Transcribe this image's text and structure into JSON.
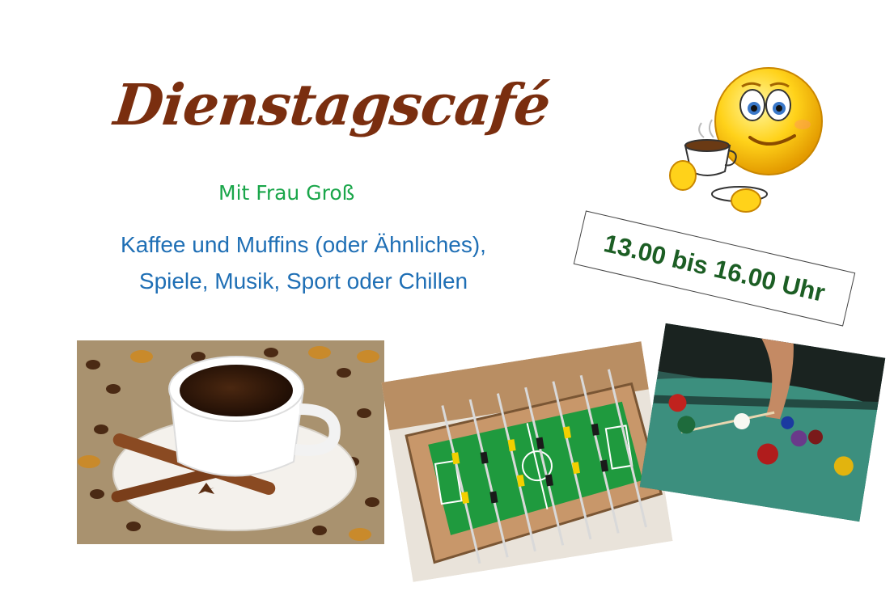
{
  "flyer": {
    "title": "Dienstagscafé",
    "host": "Mit Frau Groß",
    "description_line1": "Kaffee und Muffins (oder Ähnliches),",
    "description_line2": "Spiele, Musik, Sport oder Chillen",
    "time": "13.00 bis 16.00 Uhr"
  },
  "images": {
    "emoji": "coffee-drinking-smiley",
    "photo1": "coffee-cup-with-beans",
    "photo2": "foosball-table",
    "photo3": "billiard-table"
  },
  "colors": {
    "title": "#7a2e0f",
    "host": "#1aa64a",
    "description": "#1f6fb5",
    "time": "#1c5e24"
  }
}
